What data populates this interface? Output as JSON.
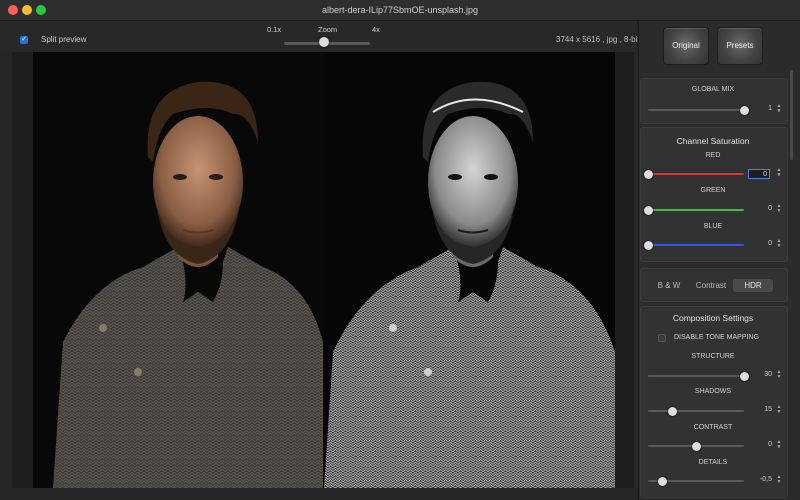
{
  "window": {
    "title": "albert-dera-ILip77SbmOE-unsplash.jpg"
  },
  "toolbar": {
    "split_preview_label": "Split preview",
    "split_preview_checked": true,
    "zoom_label": "Zoom",
    "zoom_min_label": "0.1x",
    "zoom_max_label": "4x",
    "zoom_level_fraction": 0.47,
    "image_info": "3744 x 5616 , jpg , 8-bit"
  },
  "icons": {
    "checkbox": "checkmark-icon",
    "stepper": "stepper-arrows-icon"
  },
  "panel": {
    "original_button": "Original",
    "presets_button": "Presets",
    "global_mix": {
      "label": "GLOBAL MIX",
      "value": "1",
      "level": 1.0
    },
    "channel_saturation": {
      "title": "Channel Saturation",
      "channels": [
        {
          "label": "RED",
          "value": "0",
          "level": 0.0,
          "color": "#d23a3a"
        },
        {
          "label": "GREEN",
          "value": "0",
          "level": 0.0,
          "color": "#3fbf3f"
        },
        {
          "label": "BLUE",
          "value": "0",
          "level": 0.0,
          "color": "#3a56d8"
        }
      ]
    },
    "mode_segments": {
      "options": [
        "B & W",
        "Contrast",
        "HDR"
      ],
      "selected": "HDR"
    },
    "composition": {
      "title": "Composition Settings",
      "disable_tone_mapping_label": "DISABLE TONE MAPPING",
      "disable_tone_mapping_checked": false,
      "sliders": [
        {
          "label": "STRUCTURE",
          "value": "30",
          "level": 1.0
        },
        {
          "label": "SHADOWS",
          "value": "15",
          "level": 0.25
        },
        {
          "label": "CONTRAST",
          "value": "0",
          "level": 0.5
        },
        {
          "label": "DETAILS",
          "value": "-0,5",
          "level": 0.15
        }
      ]
    }
  },
  "colors": {
    "accent": "#2e6fe0",
    "selected_field_border": "#4c82d8"
  }
}
